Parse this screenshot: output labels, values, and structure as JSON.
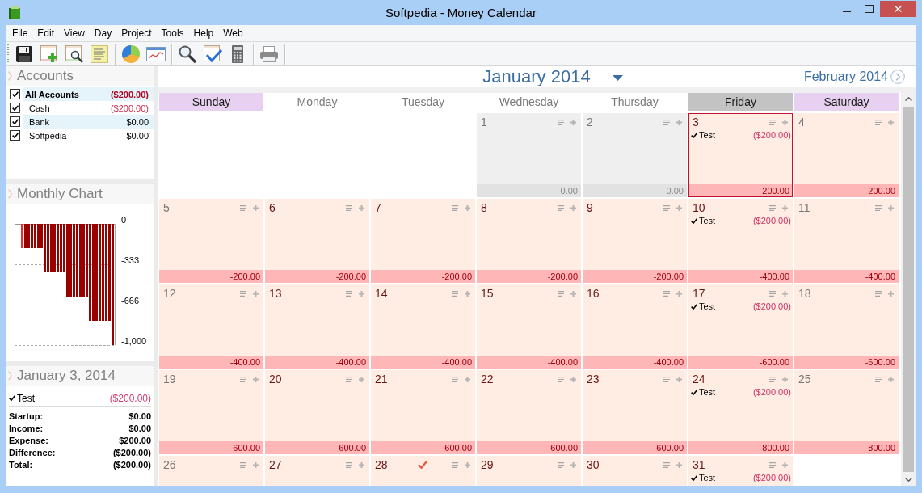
{
  "window": {
    "title": "Softpedia - Money Calendar"
  },
  "menu": [
    "File",
    "Edit",
    "View",
    "Day",
    "Project",
    "Tools",
    "Help",
    "Web"
  ],
  "accounts": {
    "title": "Accounts",
    "items": [
      {
        "name": "All Accounts",
        "amount": "($200.00)",
        "kind": "total",
        "checked": true,
        "negative": true
      },
      {
        "name": "Cash",
        "amount": "($200.00)",
        "kind": "account",
        "checked": true,
        "negative": true
      },
      {
        "name": "Bank",
        "amount": "$0.00",
        "kind": "account",
        "checked": true,
        "negative": false
      },
      {
        "name": "Softpedia",
        "amount": "$0.00",
        "kind": "account",
        "checked": true,
        "negative": false
      }
    ]
  },
  "monthly_chart": {
    "title": "Monthly Chart",
    "chart_data": {
      "type": "bar",
      "values": [
        0,
        0,
        -200,
        -200,
        -200,
        -200,
        -200,
        -200,
        -200,
        -400,
        -400,
        -400,
        -400,
        -400,
        -400,
        -400,
        -600,
        -600,
        -600,
        -600,
        -600,
        -600,
        -600,
        -800,
        -800,
        -800,
        -800,
        -800,
        -800,
        -800,
        -1000
      ],
      "ylim": [
        -1000,
        0
      ],
      "yticks": [
        {
          "value": 0,
          "label": "0"
        },
        {
          "value": -333,
          "label": "-333"
        },
        {
          "value": -666,
          "label": "-666"
        },
        {
          "value": -1000,
          "label": "-1,000"
        }
      ]
    }
  },
  "day_summary": {
    "title": "January 3, 2014",
    "entries": [
      {
        "label": "Test",
        "amount": "($200.00)",
        "done": true
      }
    ],
    "totals": [
      {
        "label": "Startup:",
        "value": "$0.00"
      },
      {
        "label": "Income:",
        "value": "$0.00"
      },
      {
        "label": "Expense:",
        "value": "$200.00"
      },
      {
        "label": "Difference:",
        "value": "($200.00)"
      },
      {
        "label": "Total:",
        "value": "($200.00)"
      }
    ]
  },
  "calendar": {
    "month": "January 2014",
    "next_month": "February 2014",
    "weekdays": [
      {
        "label": "Sunday",
        "kind": "weekend",
        "selected": false
      },
      {
        "label": "Monday",
        "kind": "weekday",
        "selected": false
      },
      {
        "label": "Tuesday",
        "kind": "weekday",
        "selected": false
      },
      {
        "label": "Wednesday",
        "kind": "weekday",
        "selected": false
      },
      {
        "label": "Thursday",
        "kind": "weekday",
        "selected": false
      },
      {
        "label": "Friday",
        "kind": "weekday",
        "selected": true
      },
      {
        "label": "Saturday",
        "kind": "weekend",
        "selected": false
      }
    ],
    "weeks": [
      [
        {
          "kind": "blank"
        },
        {
          "kind": "blank"
        },
        {
          "kind": "blank"
        },
        {
          "kind": "day",
          "day": "1",
          "negative": false,
          "selected": false,
          "today": false,
          "balance": "0.00"
        },
        {
          "kind": "day",
          "day": "2",
          "negative": false,
          "selected": false,
          "today": false,
          "balance": "0.00"
        },
        {
          "kind": "day",
          "day": "3",
          "negative": true,
          "selected": true,
          "today": false,
          "entries": [
            {
              "label": "Test",
              "amount": "($200.00)",
              "done": true
            }
          ],
          "balance": "-200.00"
        },
        {
          "kind": "day",
          "day": "4",
          "negative": true,
          "selected": false,
          "today": false,
          "balance": "-200.00"
        }
      ],
      [
        {
          "kind": "day",
          "day": "5",
          "negative": true,
          "selected": false,
          "today": false,
          "balance": "-200.00"
        },
        {
          "kind": "day",
          "day": "6",
          "negative": true,
          "selected": false,
          "today": false,
          "balance": "-200.00"
        },
        {
          "kind": "day",
          "day": "7",
          "negative": true,
          "selected": false,
          "today": false,
          "balance": "-200.00"
        },
        {
          "kind": "day",
          "day": "8",
          "negative": true,
          "selected": false,
          "today": false,
          "balance": "-200.00"
        },
        {
          "kind": "day",
          "day": "9",
          "negative": true,
          "selected": false,
          "today": false,
          "balance": "-200.00"
        },
        {
          "kind": "day",
          "day": "10",
          "negative": true,
          "selected": false,
          "today": false,
          "entries": [
            {
              "label": "Test",
              "amount": "($200.00)",
              "done": true
            }
          ],
          "balance": "-400.00"
        },
        {
          "kind": "day",
          "day": "11",
          "negative": true,
          "selected": false,
          "today": false,
          "balance": "-400.00"
        }
      ],
      [
        {
          "kind": "day",
          "day": "12",
          "negative": true,
          "selected": false,
          "today": false,
          "balance": "-400.00"
        },
        {
          "kind": "day",
          "day": "13",
          "negative": true,
          "selected": false,
          "today": false,
          "balance": "-400.00"
        },
        {
          "kind": "day",
          "day": "14",
          "negative": true,
          "selected": false,
          "today": false,
          "balance": "-400.00"
        },
        {
          "kind": "day",
          "day": "15",
          "negative": true,
          "selected": false,
          "today": false,
          "balance": "-400.00"
        },
        {
          "kind": "day",
          "day": "16",
          "negative": true,
          "selected": false,
          "today": false,
          "balance": "-400.00"
        },
        {
          "kind": "day",
          "day": "17",
          "negative": true,
          "selected": false,
          "today": false,
          "entries": [
            {
              "label": "Test",
              "amount": "($200.00)",
              "done": true
            }
          ],
          "balance": "-600.00"
        },
        {
          "kind": "day",
          "day": "18",
          "negative": true,
          "selected": false,
          "today": false,
          "balance": "-600.00"
        }
      ],
      [
        {
          "kind": "day",
          "day": "19",
          "negative": true,
          "selected": false,
          "today": false,
          "balance": "-600.00"
        },
        {
          "kind": "day",
          "day": "20",
          "negative": true,
          "selected": false,
          "today": false,
          "balance": "-600.00"
        },
        {
          "kind": "day",
          "day": "21",
          "negative": true,
          "selected": false,
          "today": false,
          "balance": "-600.00"
        },
        {
          "kind": "day",
          "day": "22",
          "negative": true,
          "selected": false,
          "today": false,
          "balance": "-600.00"
        },
        {
          "kind": "day",
          "day": "23",
          "negative": true,
          "selected": false,
          "today": false,
          "balance": "-600.00"
        },
        {
          "kind": "day",
          "day": "24",
          "negative": true,
          "selected": false,
          "today": false,
          "entries": [
            {
              "label": "Test",
              "amount": "($200.00)",
              "done": true
            }
          ],
          "balance": "-800.00"
        },
        {
          "kind": "day",
          "day": "25",
          "negative": true,
          "selected": false,
          "today": false,
          "balance": "-800.00"
        }
      ],
      [
        {
          "kind": "day",
          "day": "26",
          "negative": true,
          "selected": false,
          "today": false
        },
        {
          "kind": "day",
          "day": "27",
          "negative": true,
          "selected": false,
          "today": false
        },
        {
          "kind": "day",
          "day": "28",
          "negative": true,
          "selected": false,
          "today": true
        },
        {
          "kind": "day",
          "day": "29",
          "negative": true,
          "selected": false,
          "today": false
        },
        {
          "kind": "day",
          "day": "30",
          "negative": true,
          "selected": false,
          "today": false
        },
        {
          "kind": "day",
          "day": "31",
          "negative": true,
          "selected": false,
          "today": false,
          "entries": [
            {
              "label": "Test",
              "amount": "($200.00)",
              "done": true
            }
          ]
        },
        {
          "kind": "blank"
        }
      ]
    ]
  }
}
